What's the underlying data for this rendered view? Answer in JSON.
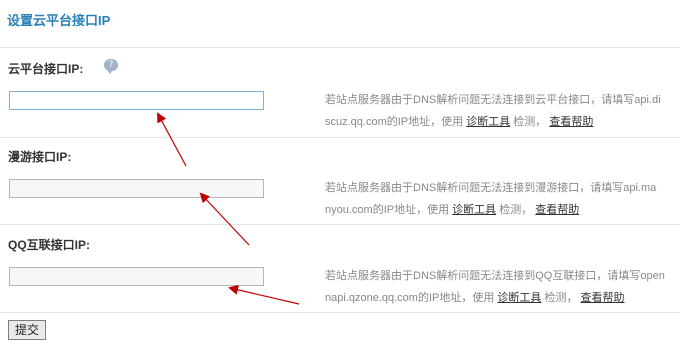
{
  "page": {
    "title": "设置云平台接口IP"
  },
  "fields": [
    {
      "label": "云平台接口IP:",
      "value": "",
      "tip_line1": "若站点服务器由于DNS解析问题无法连接到云平台接口，请填写api.di",
      "tip_line2_prefix": "scuz.qq.com的IP地址，使用",
      "tip_link1": "诊断工具",
      "tip_mid": "检测，",
      "tip_link2": "查看帮助"
    },
    {
      "label": "漫游接口IP:",
      "value": "",
      "tip_line1": "若站点服务器由于DNS解析问题无法连接到漫游接口，请填写api.ma",
      "tip_line2_prefix": "nyou.com的IP地址，使用",
      "tip_link1": "诊断工具",
      "tip_mid": "检测，",
      "tip_link2": "查看帮助"
    },
    {
      "label": "QQ互联接口IP:",
      "value": "",
      "tip_line1": "若站点服务器由于DNS解析问题无法连接到QQ互联接口，请填写open",
      "tip_line2_prefix": "napi.qzone.qq.com的IP地址，使用",
      "tip_link1": "诊断工具",
      "tip_mid": "检测，",
      "tip_link2": "查看帮助"
    }
  ],
  "submit_label": "提交",
  "colors": {
    "title": "#2a80b9",
    "arrow": "#c00000",
    "focus_border": "#7fb0d8"
  },
  "icons": {
    "help": "help-bubble-icon"
  }
}
